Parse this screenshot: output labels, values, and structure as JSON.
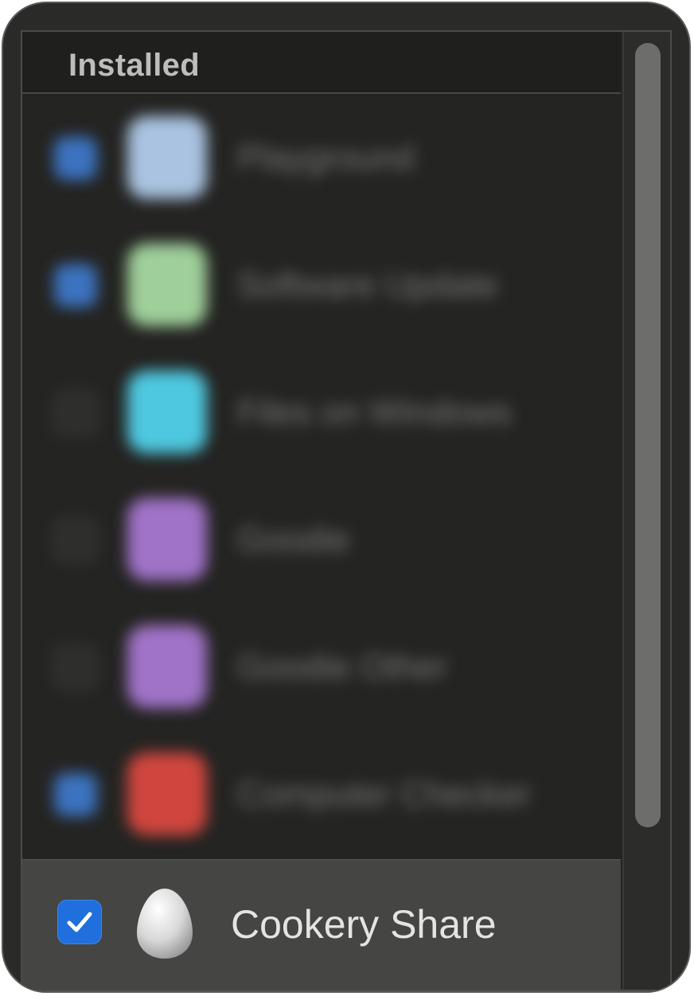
{
  "header": {
    "title": "Installed"
  },
  "list": {
    "items": [
      {
        "label": "Playground",
        "checked": true,
        "icon_color": "#a9c3e0"
      },
      {
        "label": "Software Update",
        "checked": true,
        "icon_color": "#9fcf9a"
      },
      {
        "label": "Files on Windows",
        "checked": false,
        "icon_color": "#4ec8e0"
      },
      {
        "label": "Goodie",
        "checked": false,
        "icon_color": "#a173c8"
      },
      {
        "label": "Goodie Other",
        "checked": false,
        "icon_color": "#a173c8"
      },
      {
        "label": "Computer Checker",
        "checked": true,
        "icon_color": "#d0463e"
      }
    ]
  },
  "selected": {
    "label": "Cookery Share",
    "checked": true,
    "icon": "egg-icon"
  },
  "colors": {
    "accent": "#1f6fdc",
    "background": "#242422",
    "selected_row": "#454543"
  }
}
